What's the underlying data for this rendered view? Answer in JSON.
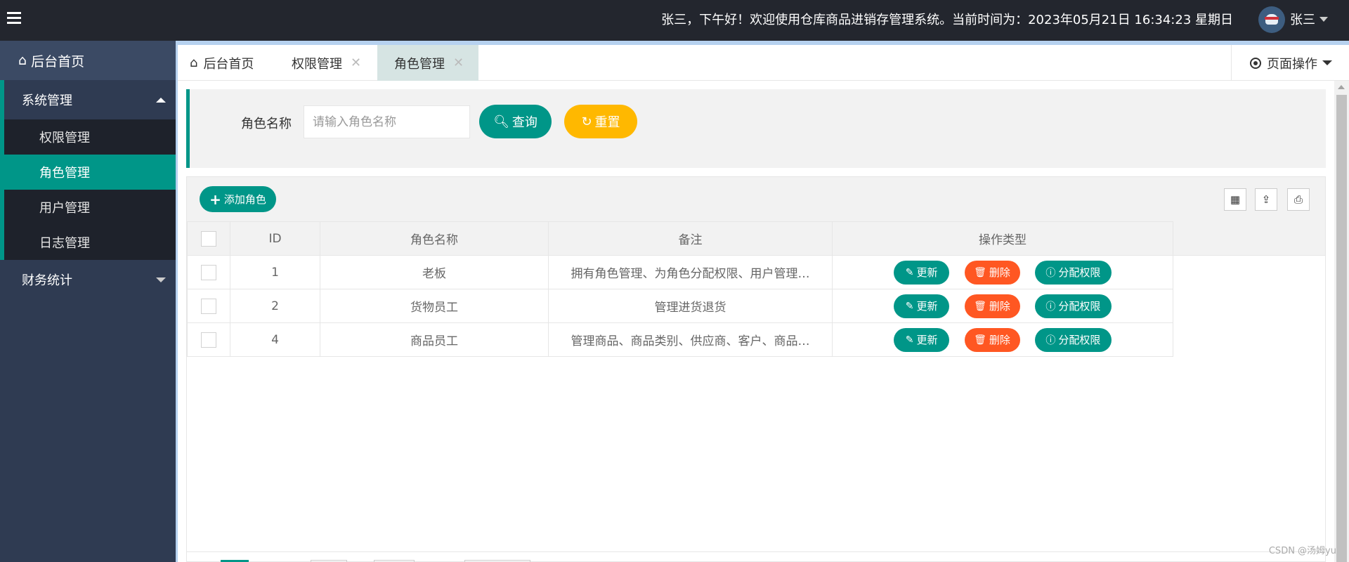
{
  "header": {
    "welcome_text": "张三，下午好！欢迎使用仓库商品进销存管理系统。当前时间为：2023年05月21日 16:34:23 星期日",
    "user_name": "张三"
  },
  "sidebar": {
    "home_label": "后台首页",
    "groups": [
      {
        "label": "系统管理",
        "items": [
          {
            "label": "权限管理"
          },
          {
            "label": "角色管理"
          },
          {
            "label": "用户管理"
          },
          {
            "label": "日志管理"
          }
        ]
      },
      {
        "label": "财务统计"
      }
    ]
  },
  "tabs": [
    {
      "label": "后台首页"
    },
    {
      "label": "权限管理"
    },
    {
      "label": "角色管理"
    }
  ],
  "page_ops_label": "页面操作",
  "search": {
    "label": "角色名称",
    "placeholder": "请输入角色名称",
    "query_label": "查询",
    "reset_label": "重置"
  },
  "toolbar": {
    "add_label": "添加角色"
  },
  "table": {
    "headers": [
      "ID",
      "角色名称",
      "备注",
      "操作类型"
    ],
    "rows": [
      {
        "id": "1",
        "name": "老板",
        "remark": "拥有角色管理、为角色分配权限、用户管理…"
      },
      {
        "id": "2",
        "name": "货物员工",
        "remark": "管理进货退货"
      },
      {
        "id": "4",
        "name": "商品员工",
        "remark": "管理商品、商品类别、供应商、客户、商品…"
      }
    ],
    "actions": {
      "update": "更新",
      "delete": "删除",
      "assign": "分配权限"
    }
  },
  "watermark": "CSDN @汤姆yu",
  "colors": {
    "primary": "#009688",
    "warning": "#ffb800",
    "danger": "#ff5722",
    "header_bg": "#23262e",
    "sidebar_bg": "#2f3b52"
  }
}
